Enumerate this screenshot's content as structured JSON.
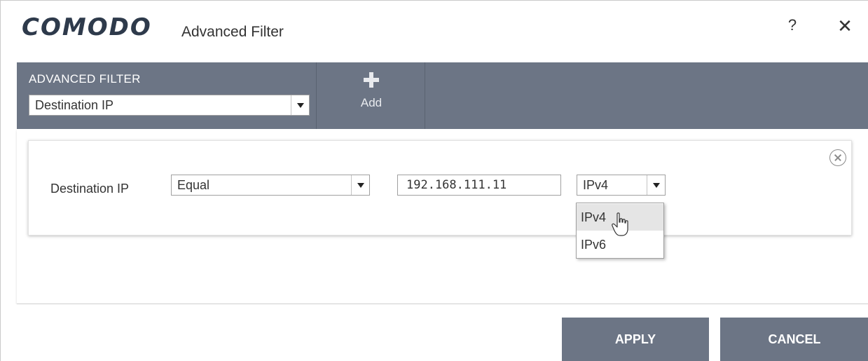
{
  "window": {
    "logo": "COMODO",
    "title": "Advanced Filter",
    "help_label": "?",
    "close_label": "✕"
  },
  "toolbar": {
    "section_label": "ADVANCED FILTER",
    "filter_select_value": "Destination IP",
    "add_label": "Add"
  },
  "filter_row": {
    "label": "Destination IP",
    "operator_value": "Equal",
    "ip_value": "192.168.111.11",
    "version_value": "IPv4"
  },
  "version_dropdown": {
    "options": [
      "IPv4",
      "IPv6"
    ],
    "hovered": "IPv4"
  },
  "footer": {
    "apply_label": "APPLY",
    "cancel_label": "CANCEL"
  },
  "colors": {
    "toolbar_bg": "#6c7585",
    "button_bg": "#6c7585",
    "logo_color": "#2e3a4b"
  }
}
